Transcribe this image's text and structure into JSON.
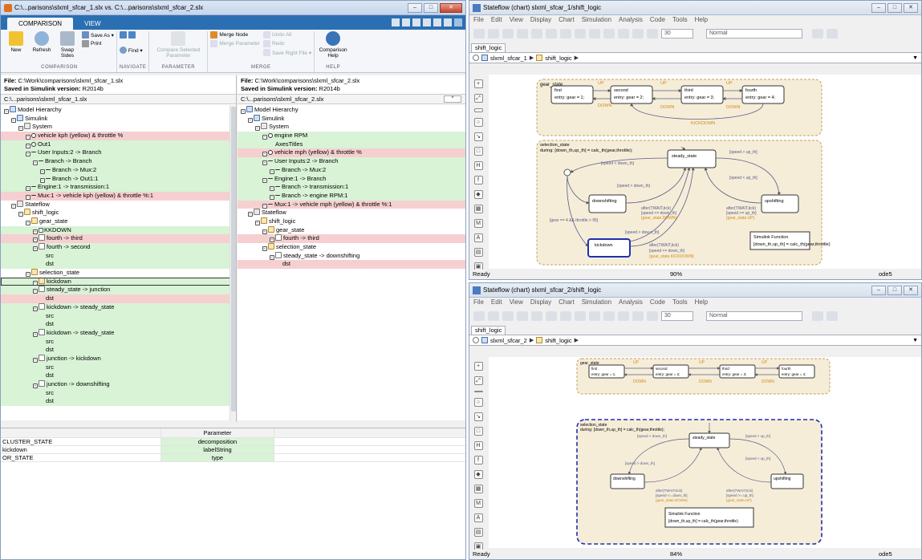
{
  "comparison": {
    "title": "C:\\...parisons\\slxml_sfcar_1.slx vs. C:\\...parisons\\slxml_sfcar_2.slx",
    "tabs": [
      "COMPARISON",
      "VIEW"
    ],
    "ribbon": {
      "new": "New",
      "refresh": "Refresh",
      "swap_sides": "Swap\nSides",
      "save_as": "Save As ▾",
      "print": "Print",
      "find": "Find ▾",
      "compare_selected": "Compare Selected\nParameter",
      "merge_node": "Merge Node",
      "merge_parameter": "Merge Parameter",
      "undo_all": "Undo All",
      "redo": "Redo",
      "save_right_file": "Save Right File ▾",
      "comparison_help": "Comparison\nHelp",
      "group_labels": [
        "COMPARISON",
        "NAVIGATE",
        "PARAMETER",
        "MERGE",
        "HELP"
      ]
    },
    "left": {
      "file_label": "File:",
      "file": "C:\\Work\\comparisons\\slxml_sfcar_1.slx",
      "saved_label": "Saved in Simulink version:",
      "saved": "R2014b",
      "path": "C:\\...parisons\\slxml_sfcar_1.slx",
      "tree": [
        {
          "t": "Model Hierarchy",
          "i": "model",
          "d": 0,
          "c": ""
        },
        {
          "t": "Simulink",
          "i": "model",
          "d": 1,
          "c": ""
        },
        {
          "t": "System",
          "i": "sys",
          "d": 2,
          "c": ""
        },
        {
          "t": "vehicle kph  (yellow) & throttle %",
          "i": "port",
          "d": 3,
          "c": "r"
        },
        {
          "t": "Out1",
          "i": "port",
          "d": 3,
          "c": "g"
        },
        {
          "t": "User Inputs:2 -> Branch",
          "i": "br",
          "d": 3,
          "c": "g"
        },
        {
          "t": "Branch -> Branch",
          "i": "br",
          "d": 4,
          "c": "g"
        },
        {
          "t": "Branch -> Mux:2",
          "i": "br",
          "d": 5,
          "c": "g"
        },
        {
          "t": "Branch -> Out1:1",
          "i": "br",
          "d": 5,
          "c": "g"
        },
        {
          "t": "Engine:1 -> transmission:1",
          "i": "br",
          "d": 3,
          "c": "g"
        },
        {
          "t": "Mux:1 -> vehicle kph  (yellow) & throttle %:1",
          "i": "br",
          "d": 3,
          "c": "r"
        },
        {
          "t": "Stateflow",
          "i": "sys",
          "d": 1,
          "c": ""
        },
        {
          "t": "shift_logic",
          "i": "st",
          "d": 2,
          "c": ""
        },
        {
          "t": "gear_state",
          "i": "st",
          "d": 3,
          "c": ""
        },
        {
          "t": "KKDOWN",
          "i": "ex",
          "d": 4,
          "c": "g"
        },
        {
          "t": "fourth -> third",
          "i": "tr2",
          "d": 4,
          "c": "r"
        },
        {
          "t": "fourth -> second",
          "i": "tr2",
          "d": 4,
          "c": "g"
        },
        {
          "t": "src",
          "i": "",
          "d": 5,
          "c": "g"
        },
        {
          "t": "dst",
          "i": "",
          "d": 5,
          "c": "g"
        },
        {
          "t": "selection_state",
          "i": "st",
          "d": 3,
          "c": ""
        },
        {
          "t": "kickdown",
          "i": "st",
          "d": 4,
          "c": "g",
          "sel": true
        },
        {
          "t": "steady_state -> junction",
          "i": "tr2",
          "d": 4,
          "c": "g"
        },
        {
          "t": "dst",
          "i": "",
          "d": 5,
          "c": "r"
        },
        {
          "t": "kickdown -> steady_state",
          "i": "tr2",
          "d": 4,
          "c": "g"
        },
        {
          "t": "src",
          "i": "",
          "d": 5,
          "c": "g"
        },
        {
          "t": "dst",
          "i": "",
          "d": 5,
          "c": "g"
        },
        {
          "t": "kickdown -> steady_state",
          "i": "tr2",
          "d": 4,
          "c": "g"
        },
        {
          "t": "src",
          "i": "",
          "d": 5,
          "c": "g"
        },
        {
          "t": "dst",
          "i": "",
          "d": 5,
          "c": "g"
        },
        {
          "t": "junction -> kickdown",
          "i": "tr2",
          "d": 4,
          "c": "g"
        },
        {
          "t": "src",
          "i": "",
          "d": 5,
          "c": "g"
        },
        {
          "t": "dst",
          "i": "",
          "d": 5,
          "c": "g"
        },
        {
          "t": "junction -> downshifting",
          "i": "tr2",
          "d": 4,
          "c": "g"
        },
        {
          "t": "src",
          "i": "",
          "d": 5,
          "c": "g"
        },
        {
          "t": "dst",
          "i": "",
          "d": 5,
          "c": "g"
        }
      ]
    },
    "right": {
      "file_label": "File:",
      "file": "C:\\Work\\comparisons\\slxml_sfcar_2.slx",
      "saved_label": "Saved in Simulink version:",
      "saved": "R2014b",
      "path": "C:\\...parisons\\slxml_sfcar_2.slx",
      "tree": [
        {
          "t": "Model Hierarchy",
          "i": "model",
          "d": 0,
          "c": ""
        },
        {
          "t": "Simulink",
          "i": "model",
          "d": 1,
          "c": ""
        },
        {
          "t": "System",
          "i": "sys",
          "d": 2,
          "c": ""
        },
        {
          "t": "engine RPM",
          "i": "port",
          "d": 3,
          "c": "g"
        },
        {
          "t": "AxesTitles",
          "i": "",
          "d": 4,
          "c": "g"
        },
        {
          "t": "vehicle mph  (yellow) & throttle %",
          "i": "port",
          "d": 3,
          "c": "r"
        },
        {
          "t": "User Inputs:2 -> Branch",
          "i": "br",
          "d": 3,
          "c": "g"
        },
        {
          "t": "Branch -> Mux:2",
          "i": "br",
          "d": 4,
          "c": "g"
        },
        {
          "t": "Engine:1 -> Branch",
          "i": "br",
          "d": 3,
          "c": "g"
        },
        {
          "t": "Branch -> transmission:1",
          "i": "br",
          "d": 4,
          "c": "g"
        },
        {
          "t": "Branch -> engine RPM:1",
          "i": "br",
          "d": 4,
          "c": "g"
        },
        {
          "t": "Mux:1 -> vehicle mph  (yellow) & throttle %:1",
          "i": "br",
          "d": 3,
          "c": "r"
        },
        {
          "t": "Stateflow",
          "i": "sys",
          "d": 1,
          "c": ""
        },
        {
          "t": "shift_logic",
          "i": "st",
          "d": 2,
          "c": ""
        },
        {
          "t": "gear_state",
          "i": "st",
          "d": 3,
          "c": ""
        },
        {
          "t": "fourth -> third",
          "i": "tr2",
          "d": 4,
          "c": "r"
        },
        {
          "t": "selection_state",
          "i": "st",
          "d": 3,
          "c": ""
        },
        {
          "t": "steady_state -> downshifting",
          "i": "tr2",
          "d": 4,
          "c": ""
        },
        {
          "t": "dst",
          "i": "",
          "d": 5,
          "c": "r"
        }
      ]
    },
    "param_header": "Parameter",
    "params": [
      {
        "name": "CLUSTER_STATE",
        "value": "decomposition"
      },
      {
        "name": "kickdown",
        "value": "labelString"
      },
      {
        "name": "OR_STATE",
        "value": "type"
      }
    ]
  },
  "sf1": {
    "title": "Stateflow (chart) slxml_sfcar_1/shift_logic",
    "menu": [
      "File",
      "Edit",
      "View",
      "Display",
      "Chart",
      "Simulation",
      "Analysis",
      "Code",
      "Tools",
      "Help"
    ],
    "sim_time": "30",
    "mode": "Normal",
    "tab": "shift_logic",
    "crumb_model": "slxml_sfcar_1",
    "crumb_chart": "shift_logic",
    "status_left": "Ready",
    "zoom": "90%",
    "solver": "ode5"
  },
  "sf2": {
    "title": "Stateflow (chart) slxml_sfcar_2/shift_logic",
    "menu": [
      "File",
      "Edit",
      "View",
      "Display",
      "Chart",
      "Simulation",
      "Analysis",
      "Code",
      "Tools",
      "Help"
    ],
    "sim_time": "30",
    "mode": "Normal",
    "tab": "shift_logic",
    "crumb_model": "slxml_sfcar_2",
    "crumb_chart": "shift_logic",
    "status_left": "Ready",
    "zoom": "84%",
    "solver": "ode5"
  },
  "diagram1": {
    "gear_state": "gear_state",
    "states": [
      {
        "name": "first",
        "entry": "entry: gear = 1;"
      },
      {
        "name": "second",
        "entry": "entry: gear = 2;"
      },
      {
        "name": "third",
        "entry": "entry: gear = 3;"
      },
      {
        "name": "fourth",
        "entry": "entry: gear = 4;"
      }
    ],
    "up": "UP",
    "down": "DOWN",
    "kickdown_evt": "KICKDOWN",
    "selection_state": "selection_state",
    "selection_during": "during: [down_th,up_th] = calc_th(gear,throttle);",
    "steady_state": "steady_state",
    "downshifting": "downshifting",
    "upshifting": "upshifting",
    "kickdown": "kickdown",
    "t_speed_lt_down": "[speed < down_th]",
    "t_speed_gt_up": "[speed > up_th]",
    "t_speed_lt_up": "[speed < up_th]",
    "t_speed_gt_down": "[speed > down_th]",
    "t_speed_gt_down2": "[speed > dow n_th]",
    "t_after_down": [
      "after(TWAIT,tick)",
      "[speed <= down_th]",
      "{gear_state.DOWN}"
    ],
    "t_after_up": [
      "after(TWAIT,tick)",
      "[speed >= up_th]",
      "{gear_state.UP}"
    ],
    "t_gear4": "[gear == 4 && throttle > 95]",
    "t_after_kick": [
      "after(TWAIT,tick)",
      "[speed <= down_th]",
      "{gear_state.KICKDOWN}"
    ],
    "fn_title": "Simulink Function",
    "fn_sig": "[down_th,up_th] = calc_th(gear,throttle)"
  },
  "diagram2": {
    "gear_state": "gear_state",
    "states": [
      {
        "name": "first",
        "entry": "entry: gear = 1;"
      },
      {
        "name": "second",
        "entry": "entry: gear = 2;"
      },
      {
        "name": "third",
        "entry": "entry: gear = 3;"
      },
      {
        "name": "fourth",
        "entry": "entry: gear = 4;"
      }
    ],
    "up": "UP",
    "down": "DOWN",
    "selection_state": "selection_state",
    "selection_during": "during: [down_th,up_th] = calc_th(gear,throttle);",
    "steady_state": "steady_state",
    "downshifting": "downshifting",
    "upshifting": "upshifting",
    "t_speed_lt_down": "[speed < down_th]",
    "t_speed_gt_up": "[speed > up_th]",
    "t_speed_lt_up": "[speed < up_th]",
    "t_speed_gt_down": "[speed > down_th]",
    "t_after_down": [
      "after(TWAIT,tick)",
      "[speed <= down_th]",
      "{gear_state.DOWN}"
    ],
    "t_after_up": [
      "after(TWAIT,tick)",
      "[speed >= up_th]",
      "{gear_state.UP}"
    ],
    "fn_title": "Simulink Function",
    "fn_sig": "[down_th,up_th] = calc_th(gear,throttle)"
  },
  "colors": {
    "added": "#d8f3d6",
    "removed": "#f6d0d0",
    "state_fill": "#f5edd8",
    "state_border": "#c2a15a",
    "transition": "#5a5a8a",
    "event_text": "#d08a1a",
    "highlight": "#1f2fb3"
  }
}
